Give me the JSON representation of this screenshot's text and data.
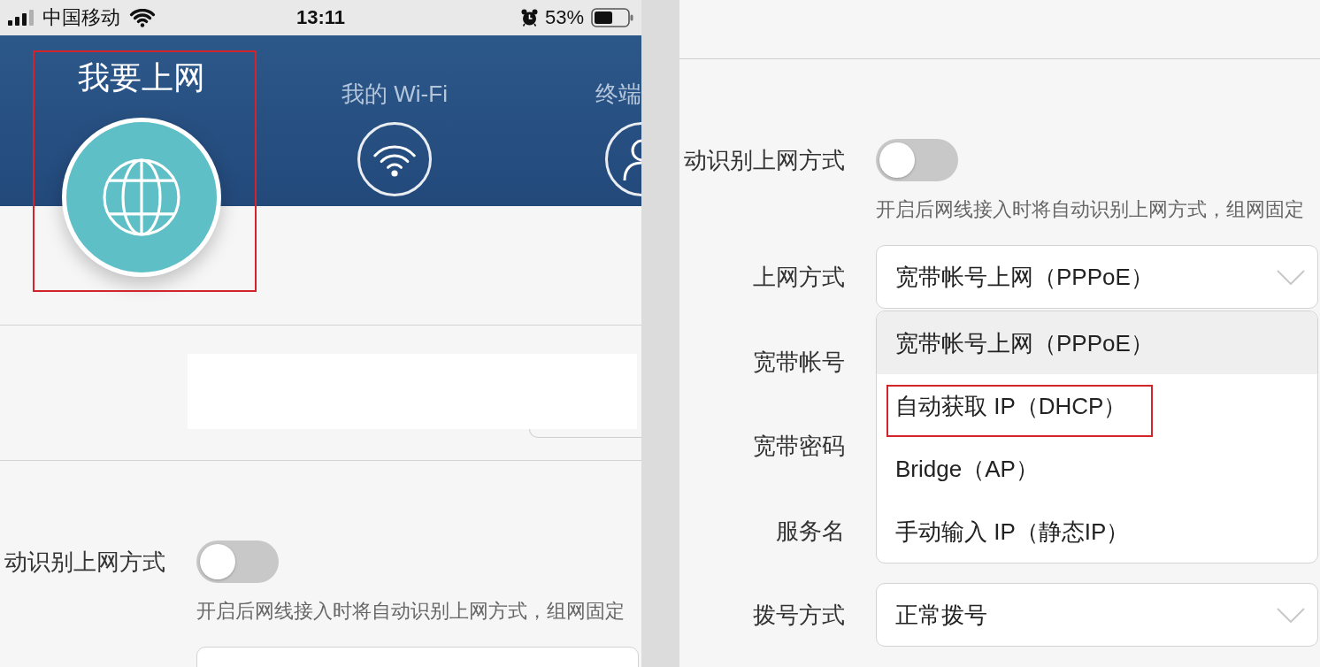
{
  "left_screen": {
    "status_bar": {
      "carrier": "中国移动",
      "time": "13:11",
      "battery": "53%"
    },
    "nav_tabs": [
      {
        "label": "我要上网",
        "selected": true,
        "annotated": true
      },
      {
        "label": "我的 Wi-Fi",
        "selected": false,
        "annotated": false
      },
      {
        "label": "终端",
        "selected": false,
        "annotated": false
      }
    ],
    "auto_detect": {
      "label": "动识别上网方式",
      "on": false,
      "hint": "开启后网线接入时将自动识别上网方式，组网固定"
    }
  },
  "right_screen": {
    "auto_detect": {
      "label": "动识别上网方式",
      "on": false,
      "hint": "开启后网线接入时将自动识别上网方式，组网固定"
    },
    "form_rows": [
      {
        "label": "上网方式",
        "value": "宽带帐号上网（PPPoE）",
        "expanded": true,
        "options": [
          {
            "label": "宽带帐号上网（PPPoE）",
            "selected": true,
            "annotated": false
          },
          {
            "label": "自动获取 IP（DHCP）",
            "selected": false,
            "annotated": true
          },
          {
            "label": "Bridge（AP）",
            "selected": false,
            "annotated": false
          },
          {
            "label": "手动输入 IP（静态IP）",
            "selected": false,
            "annotated": false
          }
        ]
      },
      {
        "label": "宽带帐号"
      },
      {
        "label": "宽带密码"
      },
      {
        "label": "服务名"
      },
      {
        "label": "拨号方式",
        "value": "正常拨号"
      }
    ]
  }
}
